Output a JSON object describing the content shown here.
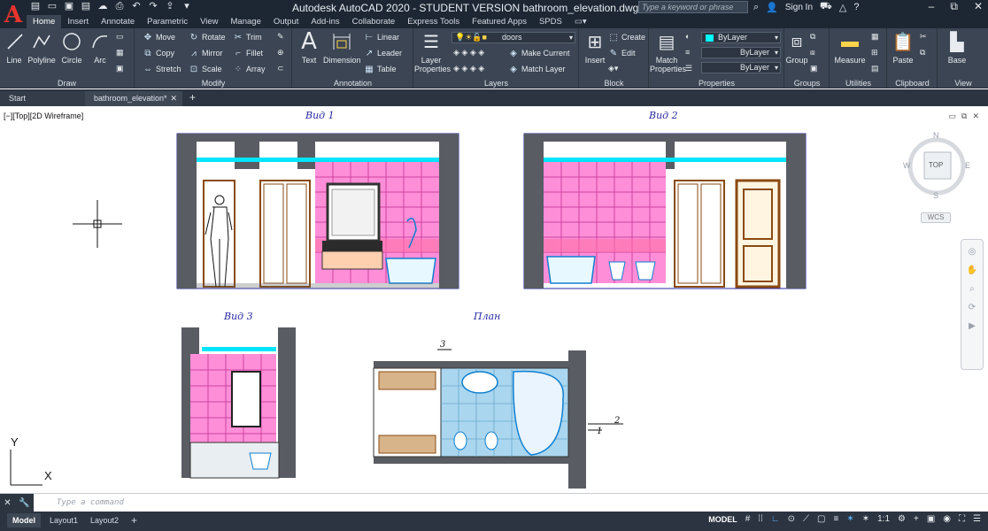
{
  "app": {
    "title": "Autodesk AutoCAD 2020 - STUDENT VERSION    bathroom_elevation.dwg",
    "search_placeholder": "Type a keyword or phrase",
    "sign_in": "Sign In"
  },
  "ribbon_tabs": [
    "Home",
    "Insert",
    "Annotate",
    "Parametric",
    "View",
    "Manage",
    "Output",
    "Add-ins",
    "Collaborate",
    "Express Tools",
    "Featured Apps",
    "SPDS"
  ],
  "draw": {
    "title": "Draw",
    "line": "Line",
    "polyline": "Polyline",
    "circle": "Circle",
    "arc": "Arc"
  },
  "modify": {
    "title": "Modify",
    "move": "Move",
    "rotate": "Rotate",
    "trim": "Trim",
    "copy": "Copy",
    "mirror": "Mirror",
    "fillet": "Fillet",
    "stretch": "Stretch",
    "scale": "Scale",
    "array": "Array"
  },
  "annotation": {
    "title": "Annotation",
    "text": "Text",
    "dimension": "Dimension",
    "linear": "Linear",
    "leader": "Leader",
    "table": "Table"
  },
  "layers": {
    "title": "Layers",
    "layer_properties": "Layer Properties",
    "current_layer": "doors",
    "make_current": "Make Current",
    "match_layer": "Match Layer"
  },
  "block": {
    "title": "Block",
    "insert": "Insert",
    "create": "Create",
    "edit": "Edit"
  },
  "properties": {
    "title": "Properties",
    "match_properties": "Match Properties",
    "color": "ByLayer",
    "linetype": "ByLayer",
    "lineweight": "ByLayer"
  },
  "groups": {
    "title": "Groups",
    "group": "Group"
  },
  "utilities": {
    "title": "Utilities",
    "measure": "Measure"
  },
  "clipboard": {
    "title": "Clipboard",
    "paste": "Paste"
  },
  "view_panel": {
    "title": "View",
    "base": "Base"
  },
  "doc_tabs": {
    "start": "Start",
    "active": "bathroom_elevation*"
  },
  "viewport": {
    "label": "[−][Top][2D Wireframe]"
  },
  "drawing": {
    "view1": "Вид 1",
    "view2": "Вид 2",
    "view3": "Вид 3",
    "plan": "План",
    "marker3": "3",
    "marker2": "2",
    "marker1": "1"
  },
  "viewcube": {
    "n": "N",
    "s": "S",
    "e": "E",
    "w": "W",
    "face": "TOP",
    "wcs": "WCS"
  },
  "ucs": {
    "x": "X",
    "y": "Y"
  },
  "command": {
    "placeholder": "Type a command"
  },
  "layouts": [
    "Model",
    "Layout1",
    "Layout2"
  ],
  "status": {
    "model": "MODEL",
    "scale": "1:1"
  },
  "colors": {
    "wall": "#595c63",
    "tile": "#ff8ed8",
    "grid": "#cc44a0",
    "fixture": "#0e7fd0",
    "cyan": "#00e5ff",
    "frame": "#2a2aa5",
    "wood": "#8a4a12"
  }
}
